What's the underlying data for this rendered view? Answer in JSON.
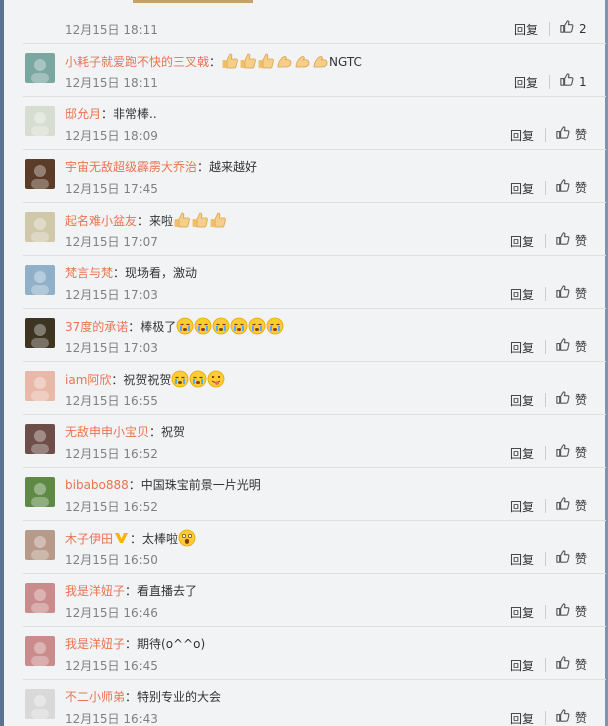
{
  "comments": [
    {
      "name": "",
      "text": "",
      "time": "12月15日 18:11",
      "reply": "回复",
      "likes": "2",
      "avatar_color": "#9b8a72",
      "icon": "none",
      "emoji": []
    },
    {
      "name": "小耗子就爱跑不快的三叉戟",
      "text": "NGTC",
      "time": "12月15日 18:11",
      "reply": "回复",
      "likes": "1",
      "avatar_color": "#7aa7a0",
      "icon": "thumbs-up-icon",
      "emoji": [
        "thumbs-up-icon",
        "thumbs-up-icon",
        "thumbs-up-icon",
        "flex-arm-icon",
        "flex-arm-icon",
        "flex-arm-icon"
      ]
    },
    {
      "name": "邸允月",
      "text": "：非常棒..",
      "time": "12月15日 18:09",
      "reply": "回复",
      "likes": "赞",
      "avatar_color": "#d7ddd0",
      "icon": "thumbs-up-icon",
      "emoji": []
    },
    {
      "name": "宇宙无敌超级霹雳大乔治",
      "text": "：越来越好",
      "time": "12月15日 17:45",
      "reply": "回复",
      "likes": "赞",
      "avatar_color": "#5a3c28",
      "icon": "thumbs-up-icon",
      "emoji": []
    },
    {
      "name": "起名难小盆友",
      "text": "：来啦",
      "time": "12月15日 17:07",
      "reply": "回复",
      "likes": "赞",
      "avatar_color": "#cfc8a9",
      "icon": "thumbs-up-icon",
      "emoji": [
        "thumbs-up-icon",
        "thumbs-up-icon",
        "thumbs-up-icon"
      ]
    },
    {
      "name": "梵言与梵",
      "text": "：现场看，激动",
      "time": "12月15日 17:03",
      "reply": "回复",
      "likes": "赞",
      "avatar_color": "#8fb0c8",
      "icon": "thumbs-up-icon",
      "emoji": []
    },
    {
      "name": "37度的承诺",
      "text": "：棒极了",
      "time": "12月15日 17:03",
      "reply": "回复",
      "likes": "赞",
      "avatar_color": "#3e3422",
      "icon": "thumbs-up-icon",
      "emoji": [
        "tear-face-icon",
        "tear-face-icon",
        "tear-face-icon",
        "tear-face-icon",
        "tear-face-icon",
        "tear-face-icon"
      ]
    },
    {
      "name": "iam阿欣",
      "text": "：祝贺祝贺",
      "time": "12月15日 16:55",
      "reply": "回复",
      "likes": "赞",
      "avatar_color": "#e8b9a8",
      "icon": "thumbs-up-icon",
      "emoji": [
        "tear-face-icon",
        "tear-face-icon",
        "tongue-face-icon"
      ]
    },
    {
      "name": "无敌申申小宝贝",
      "text": "：祝贺",
      "time": "12月15日 16:52",
      "reply": "回复",
      "likes": "赞",
      "avatar_color": "#6e4e48",
      "icon": "thumbs-up-icon",
      "emoji": []
    },
    {
      "name": "bibabo888",
      "text": "：中国珠宝前景一片光明",
      "time": "12月15日 16:52",
      "reply": "回复",
      "likes": "赞",
      "avatar_color": "#5f8a45",
      "icon": "thumbs-up-icon",
      "emoji": []
    },
    {
      "name": "木子伊田",
      "text": "：太棒啦",
      "time": "12月15日 16:50",
      "reply": "回复",
      "likes": "赞",
      "avatar_color": "#b89a8a",
      "icon": "thumbs-up-icon",
      "emoji": [
        "shock-face-icon"
      ],
      "badge": "vip-v-badge-icon"
    },
    {
      "name": "我是洋妞子",
      "text": "：看直播去了",
      "time": "12月15日 16:46",
      "reply": "回复",
      "likes": "赞",
      "avatar_color": "#c98b8b",
      "icon": "thumbs-up-icon",
      "emoji": []
    },
    {
      "name": "我是洋妞子",
      "text": "：期待(o^^o)",
      "time": "12月15日 16:45",
      "reply": "回复",
      "likes": "赞",
      "avatar_color": "#c98b8b",
      "icon": "thumbs-up-icon",
      "emoji": []
    },
    {
      "name": "不二小师弟",
      "text": "：特别专业的大会",
      "time": "12月15日 16:43",
      "reply": "回复",
      "likes": "赞",
      "avatar_color": "#d9d9d9",
      "icon": "thumbs-up-icon",
      "emoji": []
    }
  ],
  "colors": {
    "username": "#eb7350",
    "text": "#333333",
    "time": "#808080",
    "divider": "#dcdfe3",
    "background": "#f2f3f5",
    "vip_badge": "#f7b500"
  }
}
